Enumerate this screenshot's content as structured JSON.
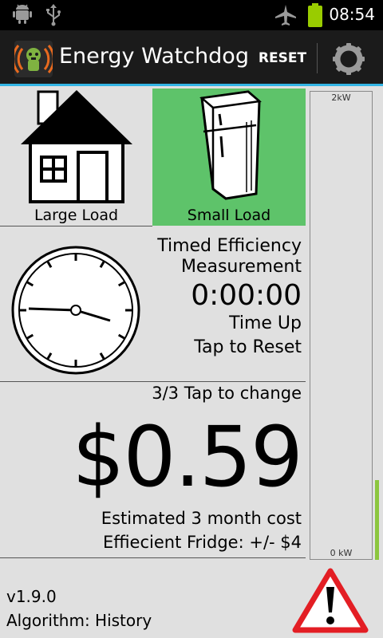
{
  "status_bar": {
    "time": "08:54",
    "icons": [
      "android-debug-icon",
      "usb-icon",
      "airplane-mode-icon",
      "battery-icon"
    ]
  },
  "action_bar": {
    "title": "Energy Watchdog",
    "reset_label": "RESET",
    "icons": [
      "app-logo-icon",
      "settings-icon"
    ]
  },
  "loads": {
    "large_label": "Large Load",
    "small_label": "Small Load",
    "selected": "small",
    "selected_color": "#5ec36a",
    "icons": [
      "house-icon",
      "fridge-icon"
    ]
  },
  "timer": {
    "title_line1": "Timed Efficiency",
    "title_line2": "Measurement",
    "elapsed": "0:00:00",
    "status_line1": "Time Up",
    "status_line2": "Tap to Reset",
    "icon": "clock-icon"
  },
  "cost": {
    "mode": "3/3 Tap to change",
    "amount": "$0.59",
    "label_line1": "Estimated 3 month cost",
    "label_line2": "Effiecient Fridge: +/- $4"
  },
  "meter": {
    "max_label": "2kW",
    "min_label": "0 kW",
    "level_color": "#8cc63f"
  },
  "footer": {
    "version": "v1.9.0",
    "algorithm": "Algorithm: History",
    "icon": "warning-icon"
  },
  "colors": {
    "accent": "#33b5e5",
    "warning": "#e31e24"
  }
}
